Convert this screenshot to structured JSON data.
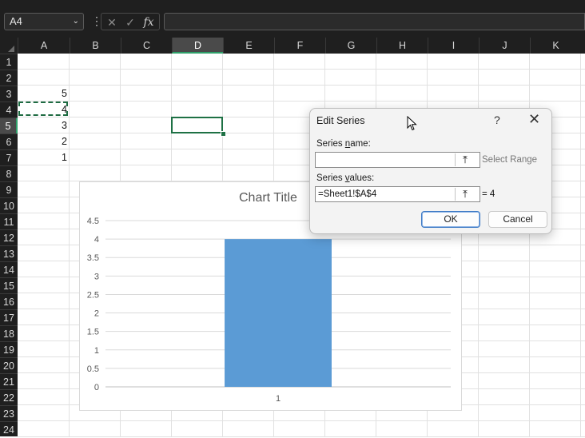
{
  "formula_bar": {
    "name_box": "A4",
    "formula": "",
    "fx_label": "fx"
  },
  "columns": [
    "A",
    "B",
    "C",
    "D",
    "E",
    "F",
    "G",
    "H",
    "I",
    "J",
    "K"
  ],
  "rows": [
    "1",
    "2",
    "3",
    "4",
    "5",
    "6",
    "7",
    "8",
    "9",
    "10",
    "11",
    "12",
    "13",
    "14",
    "15",
    "16",
    "17",
    "18",
    "19",
    "20",
    "21",
    "22",
    "23",
    "24"
  ],
  "selected_column": "D",
  "selected_row": "5",
  "cells": [
    {
      "ref": "A3",
      "value": "5"
    },
    {
      "ref": "A4",
      "value": "4"
    },
    {
      "ref": "A5",
      "value": "3"
    },
    {
      "ref": "A6",
      "value": "2"
    },
    {
      "ref": "A7",
      "value": "1"
    }
  ],
  "chart_data": {
    "type": "bar",
    "title": "Chart Title",
    "categories": [
      "1"
    ],
    "series": [
      {
        "values": [
          4
        ]
      }
    ],
    "ylim": [
      0,
      4.5
    ],
    "yticks": [
      "0",
      "0.5",
      "1",
      "1.5",
      "2",
      "2.5",
      "3",
      "3.5",
      "4",
      "4.5"
    ],
    "grid": true,
    "bar_color": "#5b9bd5"
  },
  "dialog": {
    "title": "Edit Series",
    "help": "?",
    "close": "✕",
    "series_name_label_pre": "Series ",
    "series_name_label_u": "n",
    "series_name_label_post": "ame:",
    "series_name_value": "",
    "series_name_side": "Select Range",
    "series_values_label_pre": "Series ",
    "series_values_label_u": "v",
    "series_values_label_post": "alues:",
    "series_values_value": "=Sheet1!$A$4",
    "series_values_side": "= 4",
    "ok": "OK",
    "cancel": "Cancel"
  },
  "colors": {
    "accent": "#1e7145",
    "chart_bar": "#5b9bd5",
    "header_bg": "#1f1f1f"
  }
}
